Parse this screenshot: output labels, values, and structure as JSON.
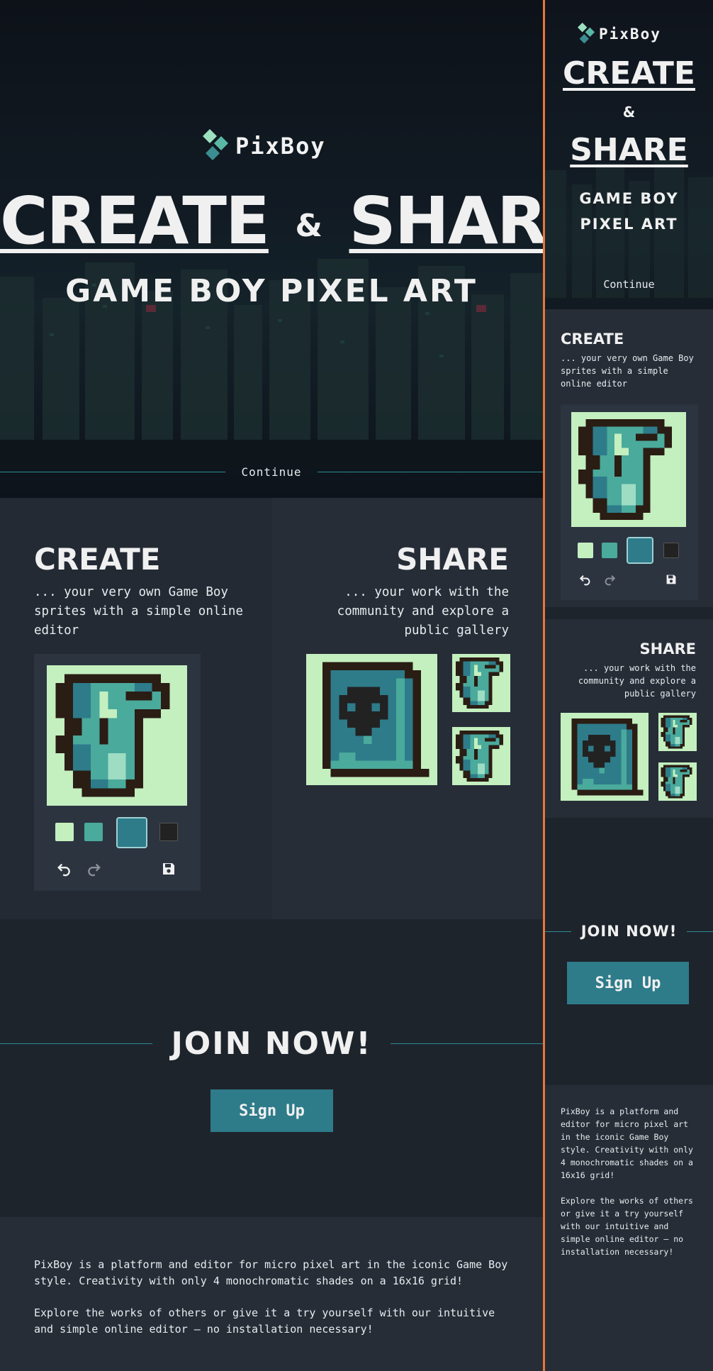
{
  "app": {
    "name": "PixBoy"
  },
  "hero": {
    "title_create": "CREATE",
    "title_amp": "&",
    "title_share": "SHARE",
    "subtitle": "GAME BOY PIXEL ART",
    "continue_label": "Continue"
  },
  "create": {
    "heading": "CREATE",
    "description": "... your very own Game Boy sprites with a simple online editor"
  },
  "share": {
    "heading": "SHARE",
    "description": "... your work with the community and explore a public gallery"
  },
  "editor": {
    "palette": [
      "#c4efbf",
      "#4aaa9c",
      "#2e7b8a",
      "#222222"
    ],
    "selected_swatch": 2,
    "tools": [
      "undo-icon",
      "redo-icon",
      "save-icon"
    ]
  },
  "join": {
    "heading": "JOIN NOW!",
    "signup_label": "Sign Up"
  },
  "footer": {
    "paragraph1": "PixBoy is a platform and editor for micro pixel art in the iconic Game Boy style. Creativity with only 4 monochromatic shades on a 16x16 grid!",
    "paragraph2": "Explore the works of others or give it a try yourself with our intuitive and simple online editor – no installation necessary!"
  },
  "colors": {
    "accent": "#2e7b8a",
    "divider": "#e8763a",
    "shade_lightest": "#c4efbf",
    "shade_light": "#4aaa9c",
    "shade_dark": "#2e7b8a",
    "shade_darkest": "#2a1d14"
  }
}
